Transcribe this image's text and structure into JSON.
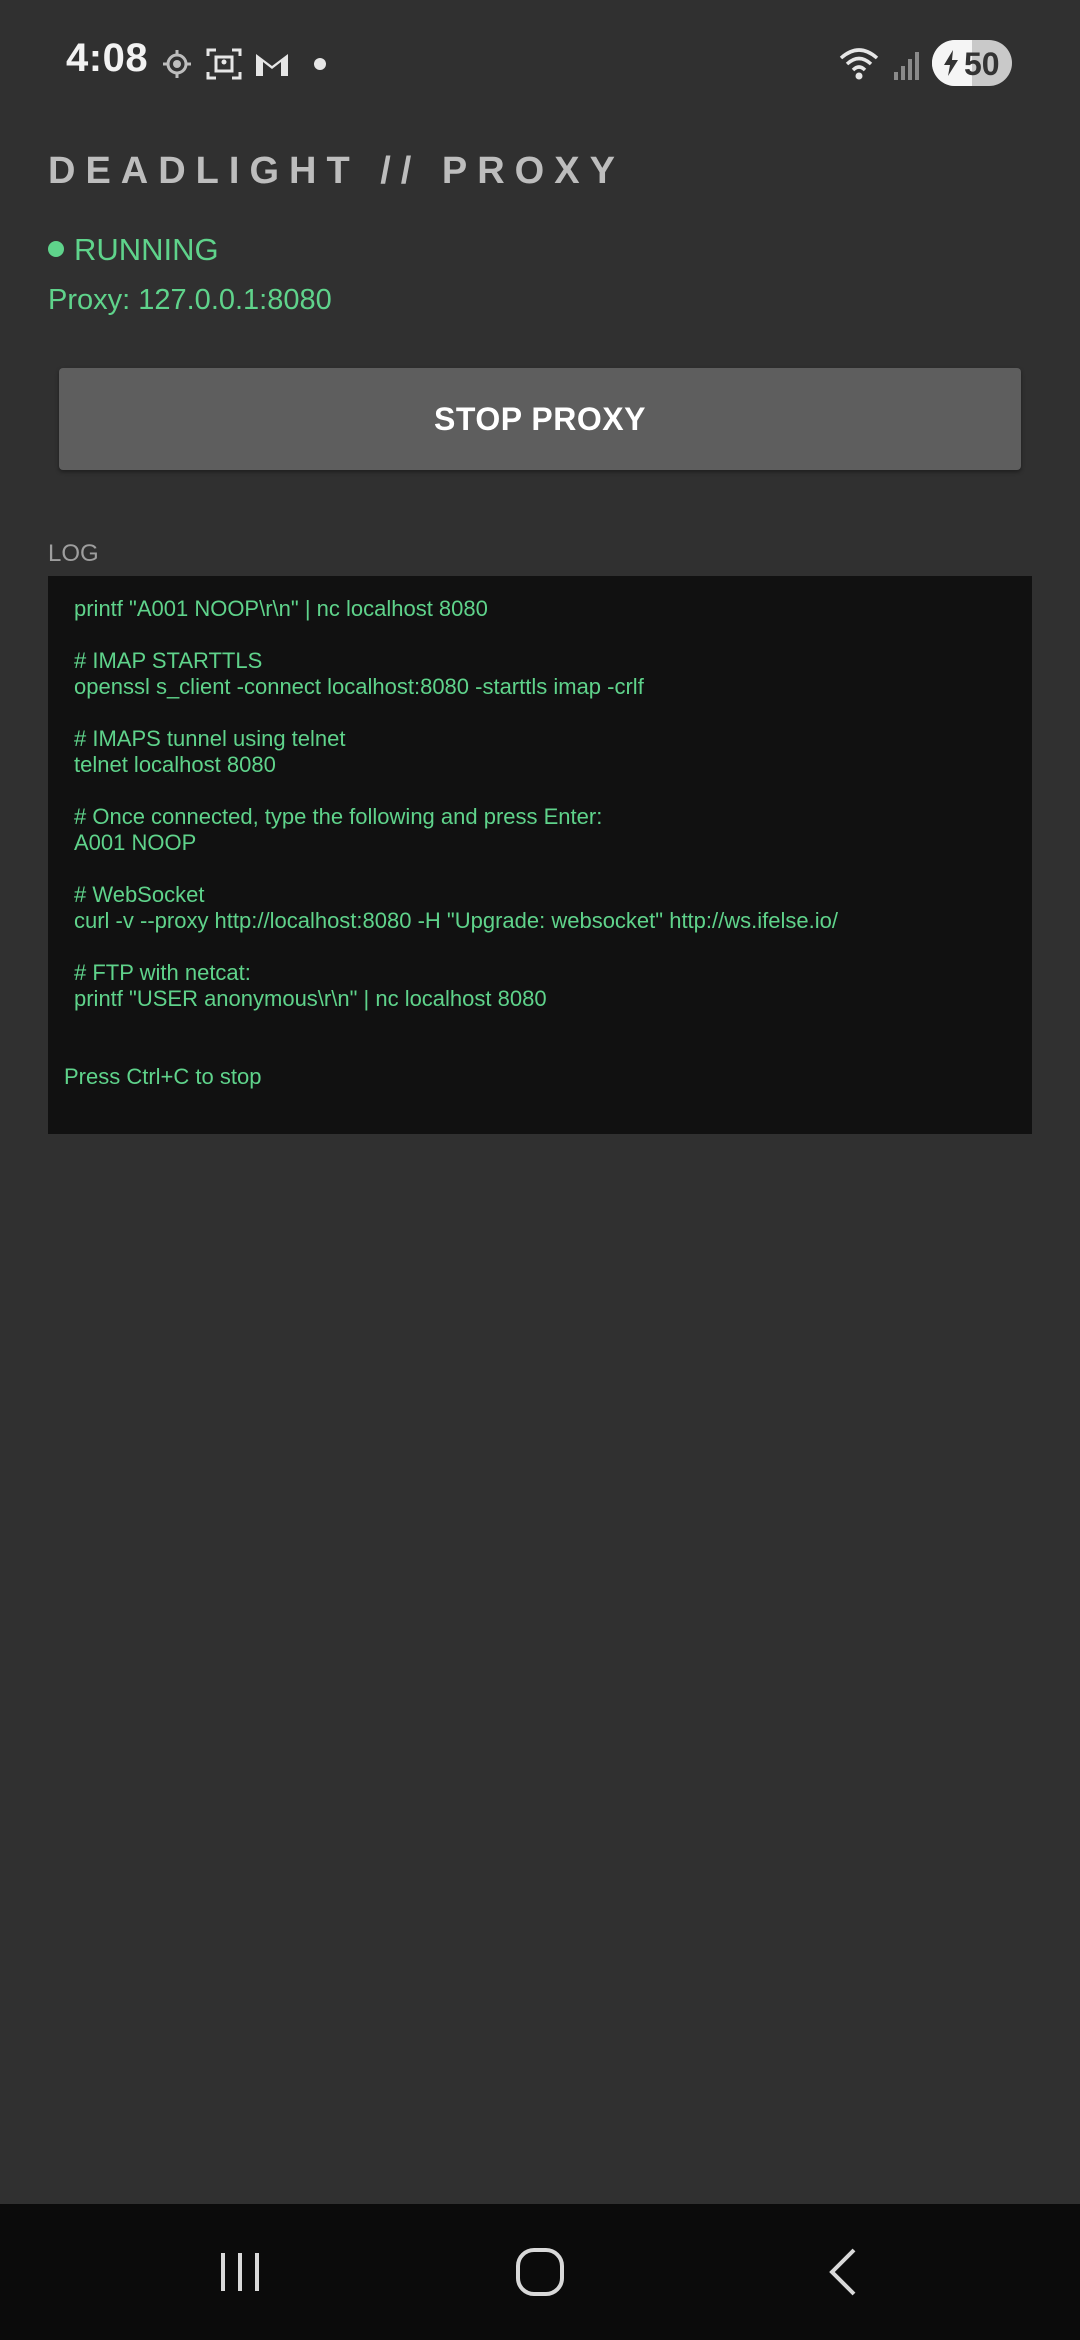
{
  "status_bar": {
    "time": "4:08",
    "battery_level": "50",
    "notification_icons": [
      "location-icon",
      "screenshot-icon",
      "gmail-icon",
      "dot-icon"
    ],
    "system_icons": [
      "wifi-icon",
      "signal-icon",
      "battery-charging-icon"
    ]
  },
  "app": {
    "title": "DEADLIGHT // PROXY",
    "status": "RUNNING",
    "proxy_address": "Proxy: 127.0.0.1:8080",
    "stop_button_label": "STOP PROXY",
    "log_label": "LOG"
  },
  "log": {
    "lines": [
      "printf \"A001 NOOP\\r\\n\" | nc localhost 8080",
      "",
      "# IMAP STARTTLS",
      "openssl s_client -connect localhost:8080 -starttls imap -crlf",
      "",
      "# IMAPS tunnel using telnet",
      "telnet localhost 8080",
      "",
      "# Once connected, type the following and press Enter:",
      "A001 NOOP",
      "",
      "# WebSocket",
      "curl -v --proxy http://localhost:8080 -H \"Upgrade: websocket\" http://ws.ifelse.io/",
      "",
      "# FTP with netcat:",
      "printf \"USER anonymous\\r\\n\" | nc localhost 8080",
      "",
      ""
    ],
    "footer": "Press Ctrl+C to stop"
  },
  "colors": {
    "background": "#303030",
    "accent_green": "#5fd38b",
    "button": "#5e5e5e",
    "log_background": "#111111",
    "nav_background": "#0b0b0b"
  },
  "nav_bar": {
    "icons": [
      "recent-apps-icon",
      "home-icon",
      "back-icon"
    ]
  }
}
